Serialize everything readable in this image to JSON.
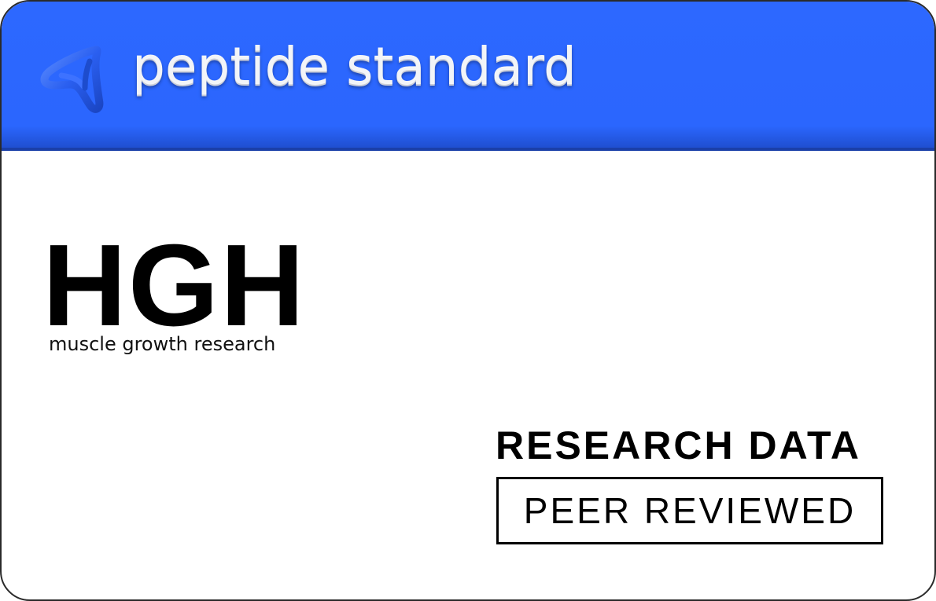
{
  "header": {
    "brand": "peptide standard",
    "logo_icon": "tri-loop-logo-icon",
    "background_color": "#2b66fe"
  },
  "product": {
    "name": "HGH",
    "subtitle": "muscle growth research"
  },
  "badges": {
    "research_data": "RESEARCH DATA",
    "peer_reviewed": "PEER REVIEWED"
  }
}
